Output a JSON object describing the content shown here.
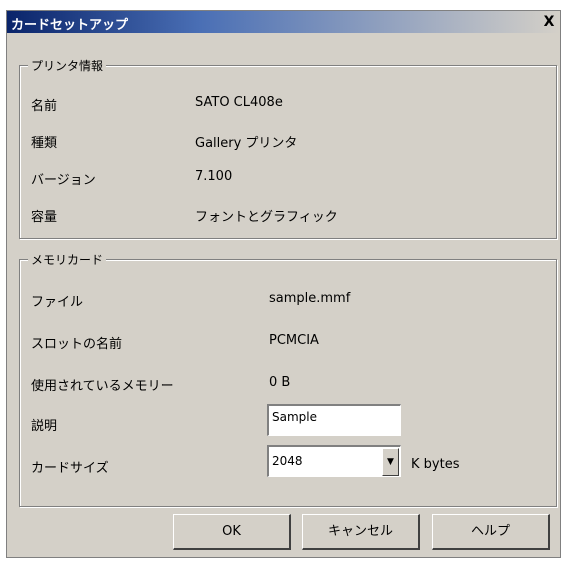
{
  "window": {
    "title": "カードセットアップ",
    "close_label": "X"
  },
  "printer_info": {
    "legend": "プリンタ情報",
    "rows": [
      {
        "label": "名前",
        "value": "SATO CL408e"
      },
      {
        "label": "種類",
        "value": "Gallery プリンタ"
      },
      {
        "label": "バージョン",
        "value": "7.100"
      },
      {
        "label": "容量",
        "value": "フォントとグラフィック"
      }
    ]
  },
  "memory_card": {
    "legend": "メモリカード",
    "file_label": "ファイル",
    "file_value": "sample.mmf",
    "slot_label": "スロットの名前",
    "slot_value": "PCMCIA",
    "used_label": "使用されているメモリー",
    "used_value": "0 B",
    "description_label": "説明",
    "description_value": "Sample",
    "size_label": "カードサイズ",
    "size_value": "2048",
    "size_unit": "K bytes"
  },
  "buttons": {
    "ok": "OK",
    "cancel": "キャンセル",
    "help": "ヘルプ"
  }
}
